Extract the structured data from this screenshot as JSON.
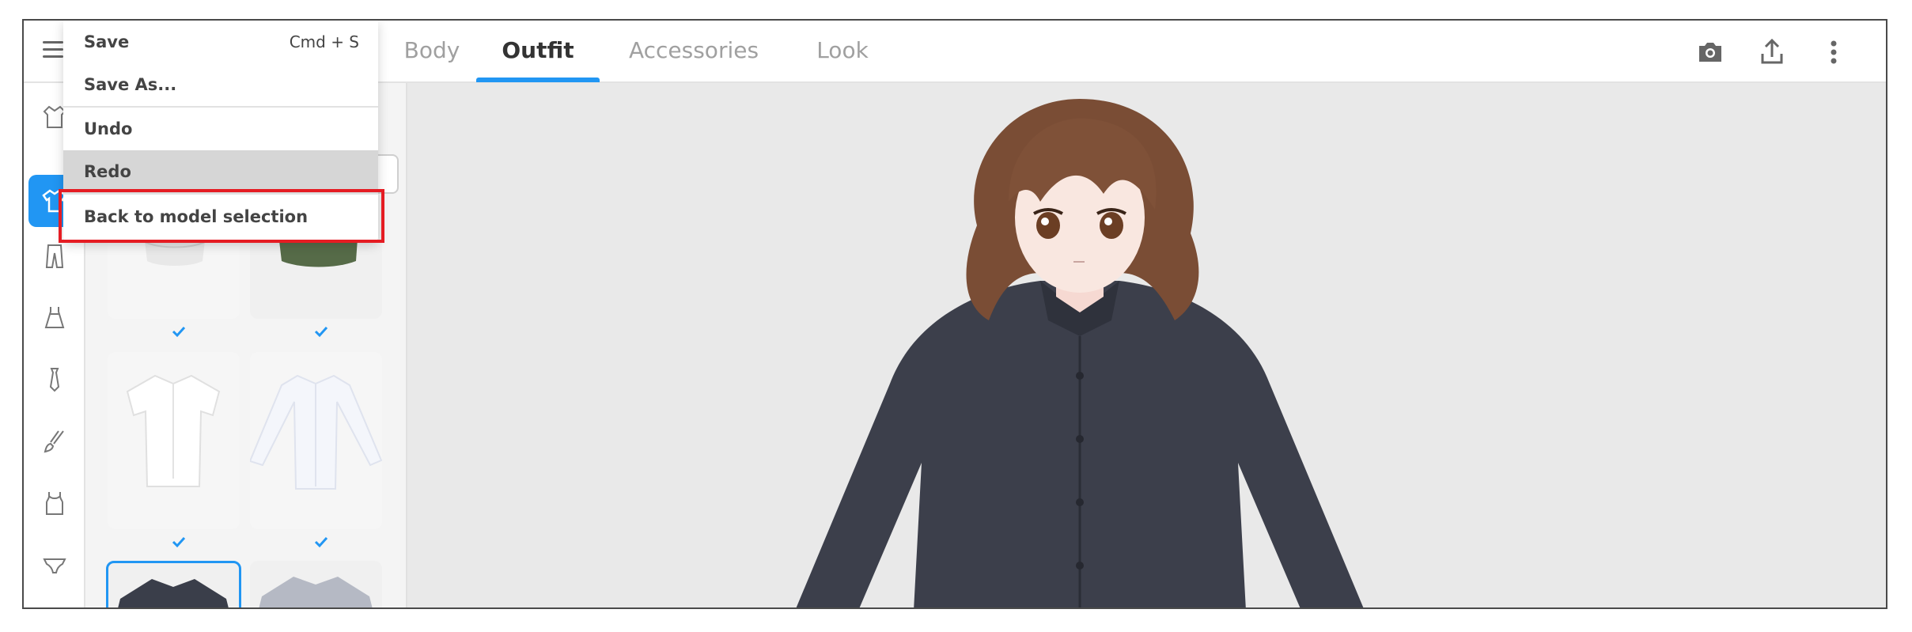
{
  "topbar": {
    "tabs": [
      {
        "label": "Body",
        "active": false
      },
      {
        "label": "Outfit",
        "active": true
      },
      {
        "label": "Accessories",
        "active": false
      },
      {
        "label": "Look",
        "active": false
      }
    ],
    "icons": [
      "camera-icon",
      "share-icon",
      "more-vertical-icon"
    ]
  },
  "menu": {
    "save_label": "Save",
    "save_shortcut": "Cmd + S",
    "save_as_label": "Save As...",
    "undo_label": "Undo",
    "redo_label": "Redo",
    "back_label": "Back to model selection"
  },
  "sidebar": {
    "items": [
      "outfit-set-icon",
      "shirt-icon",
      "pants-icon",
      "dress-icon",
      "tie-icon",
      "brush-icon",
      "tank-top-icon",
      "underwear-icon"
    ],
    "active_index": 1
  },
  "colors": {
    "accent": "#2196f3",
    "highlight": "#e51c23",
    "viewport_bg": "#e9e9e9"
  }
}
